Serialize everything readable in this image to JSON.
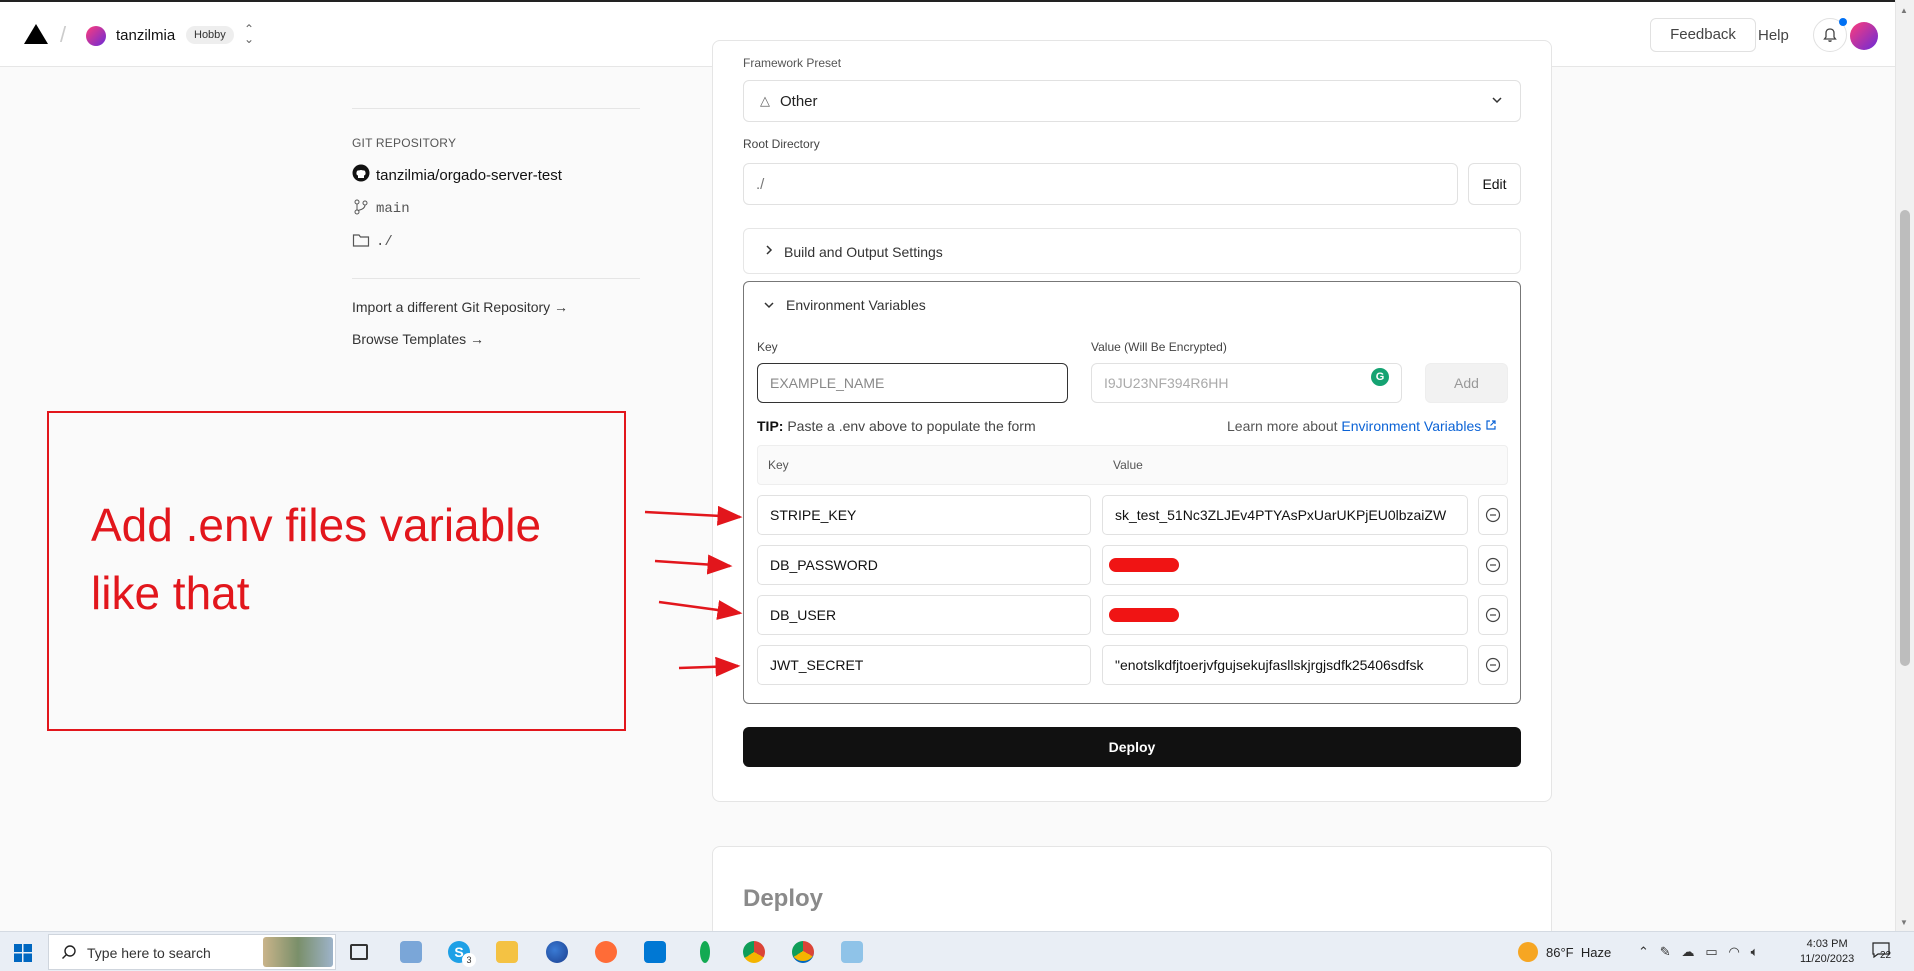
{
  "header": {
    "team_name": "tanzilmia",
    "plan_badge": "Hobby",
    "feedback_label": "Feedback",
    "help_label": "Help"
  },
  "sidebar": {
    "section_title": "GIT REPOSITORY",
    "repo_name": "tanzilmia/orgado-server-test",
    "branch": "main",
    "directory": "./",
    "import_link": "Import a different Git Repository →",
    "templates_link": "Browse Templates →"
  },
  "form": {
    "framework_label_cut": "Framework Preset",
    "framework_value": "Other",
    "root_dir_label": "Root Directory",
    "root_dir_value": "./",
    "edit_label": "Edit",
    "build_settings_label": "Build and Output Settings",
    "env_section_label": "Environment Variables",
    "key_label": "Key",
    "value_label": "Value (Will Be Encrypted)",
    "key_placeholder": "EXAMPLE_NAME",
    "value_placeholder": "I9JU23NF394R6HH",
    "add_label": "Add",
    "tip_bold": "TIP:",
    "tip_text": "Paste a .env above to populate the form",
    "learn_text": "Learn more about",
    "learn_link": "Environment Variables",
    "table_key_header": "Key",
    "table_value_header": "Value",
    "env_rows": [
      {
        "key": "STRIPE_KEY",
        "value": "sk_test_51Nc3ZLJEv4PTYAsPxUarUKPjEU0lbzaiZW",
        "redacted": false
      },
      {
        "key": "DB_PASSWORD",
        "value": "",
        "redacted": true
      },
      {
        "key": "DB_USER",
        "value": "",
        "redacted": true
      },
      {
        "key": "JWT_SECRET",
        "value": "\"enotslkdfjtoerjvfgujsekujfasllskjrgjsdfk25406sdfsk",
        "redacted": false
      }
    ],
    "deploy_label": "Deploy"
  },
  "next_section": {
    "title": "Deploy"
  },
  "annotation": {
    "text": "Add .env files variable like that",
    "color": "#e2161c"
  },
  "taskbar": {
    "search_placeholder": "Type here to search",
    "weather_temp": "86°F",
    "weather_desc": "Haze",
    "time": "4:03 PM",
    "date": "11/20/2023",
    "notification_count": "22",
    "skype_badge": "3"
  }
}
